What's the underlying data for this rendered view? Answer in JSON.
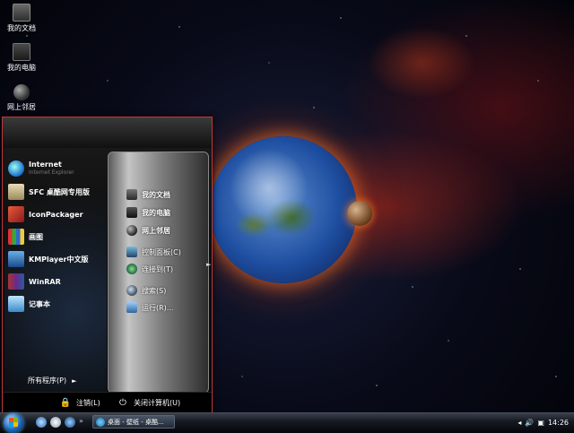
{
  "desktop": {
    "icons": [
      {
        "label": "我的文档",
        "icon": "documents-icon"
      },
      {
        "label": "我的电脑",
        "icon": "computer-icon"
      },
      {
        "label": "网上邻居",
        "icon": "network-icon"
      }
    ]
  },
  "start_menu": {
    "programs": [
      {
        "label": "Internet",
        "sub": "Internet Explorer",
        "icon": "ie-icon",
        "color": "#2a7fd4"
      },
      {
        "label": "SFC 桌酷网专用版",
        "icon": "sfc-icon",
        "color": "#c9b98a"
      },
      {
        "label": "IconPackager",
        "icon": "iconpackager-icon",
        "color": "#c0392b"
      },
      {
        "label": "画图",
        "icon": "paint-icon",
        "color": "#d4a020"
      },
      {
        "label": "KMPlayer中文版",
        "icon": "kmplayer-icon",
        "color": "#3a7bbf"
      },
      {
        "label": "WinRAR",
        "icon": "winrar-icon",
        "color": "#8a3a9a"
      },
      {
        "label": "记事本",
        "icon": "notepad-icon",
        "color": "#4aa0d8"
      }
    ],
    "all_programs": "所有程序(P)",
    "places": [
      {
        "label": "我的文档",
        "icon": "documents-icon",
        "bold": true
      },
      {
        "label": "我的电脑",
        "icon": "computer-icon",
        "bold": true
      },
      {
        "label": "网上邻居",
        "icon": "network-icon",
        "bold": true
      },
      {
        "label": "控制面板(C)",
        "icon": "control-panel-icon",
        "bold": false
      },
      {
        "label": "连接到(T)",
        "icon": "connect-icon",
        "bold": false
      },
      {
        "label": "搜索(S)",
        "icon": "search-icon",
        "bold": false
      },
      {
        "label": "运行(R)...",
        "icon": "run-icon",
        "bold": false
      }
    ],
    "logoff": "注销(L)",
    "shutdown": "关闭计算机(U)"
  },
  "taskbar": {
    "task_label": "桌面 - 壁纸 - 桌酷...",
    "clock": "14:26"
  }
}
